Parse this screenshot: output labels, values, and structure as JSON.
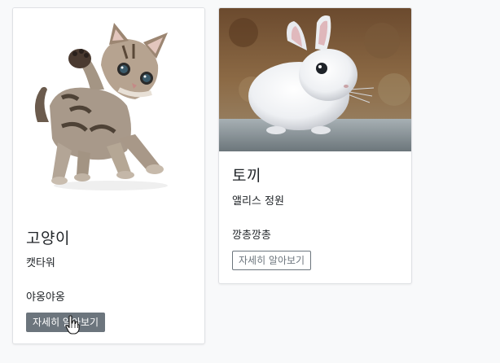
{
  "cards": [
    {
      "title": "고양이",
      "subtitle": "캣타워",
      "text": "야옹야옹",
      "button_label": "자세히 알아보기",
      "image_alt": "kitten photo"
    },
    {
      "title": "토끼",
      "subtitle": "앨리스 정원",
      "text": "깡총깡총",
      "button_label": "자세히 알아보기",
      "image_alt": "white rabbit photo"
    }
  ],
  "colors": {
    "page_background": "#f8f9fa",
    "button_secondary": "#6c757d"
  },
  "icons": {
    "cursor": "hand-pointer-icon"
  }
}
